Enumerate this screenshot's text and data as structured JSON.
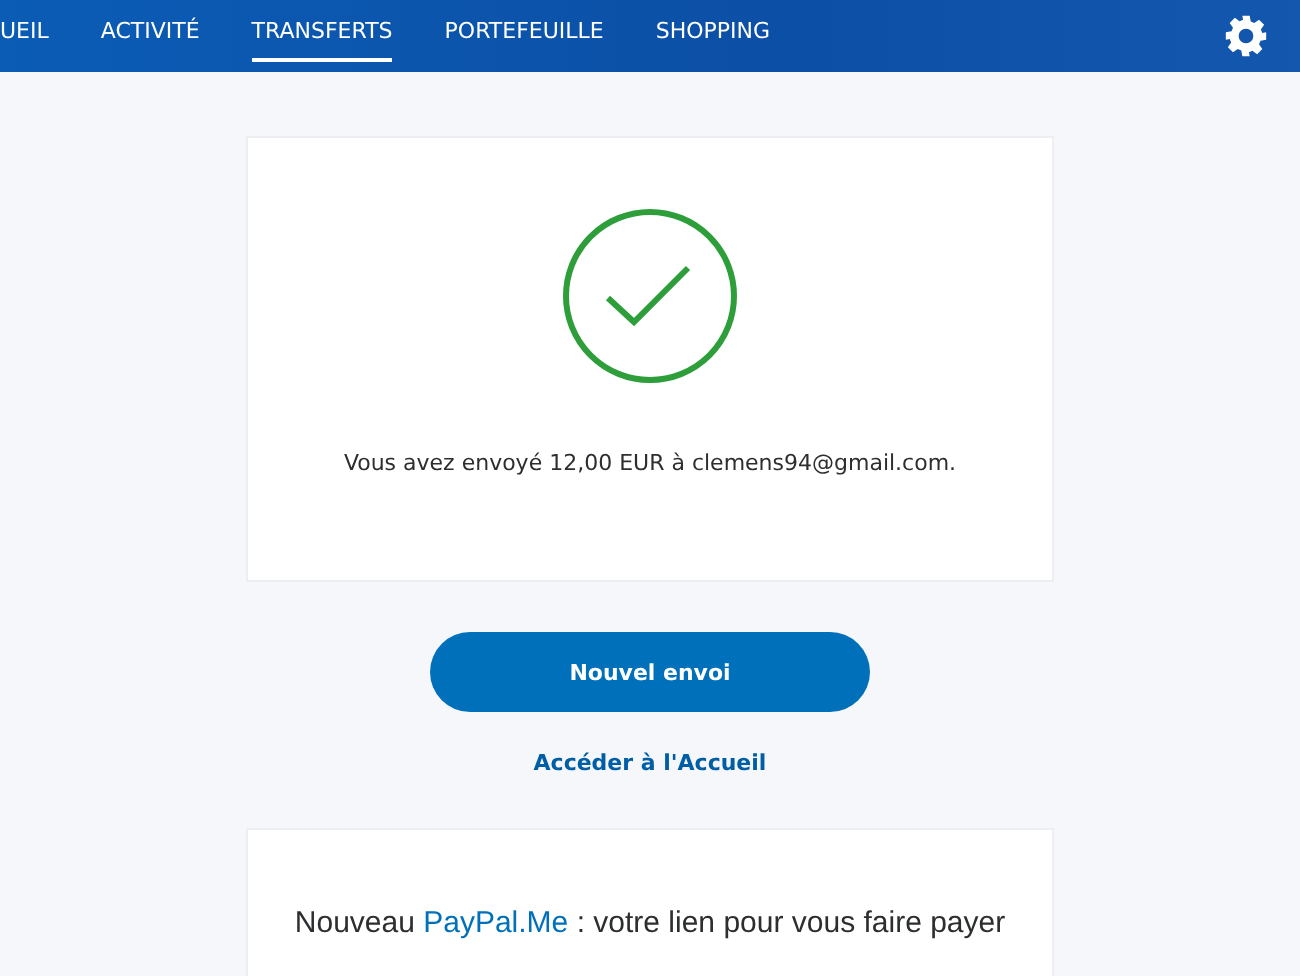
{
  "nav": {
    "tabs": [
      {
        "label": "UEIL",
        "selected": false
      },
      {
        "label": "ACTIVITÉ",
        "selected": false
      },
      {
        "label": "TRANSFERTS",
        "selected": true
      },
      {
        "label": "PORTEFEUILLE",
        "selected": false
      },
      {
        "label": "SHOPPING",
        "selected": false
      }
    ]
  },
  "confirmation": {
    "message": "Vous avez envoyé 12,00 EUR à clemens94@gmail.com."
  },
  "primary_button": "Nouvel envoi",
  "home_link": "Accéder à l'Accueil",
  "promo": {
    "before": "Nouveau ",
    "link": "PayPal.Me",
    "after": " : votre lien pour vous faire payer"
  }
}
